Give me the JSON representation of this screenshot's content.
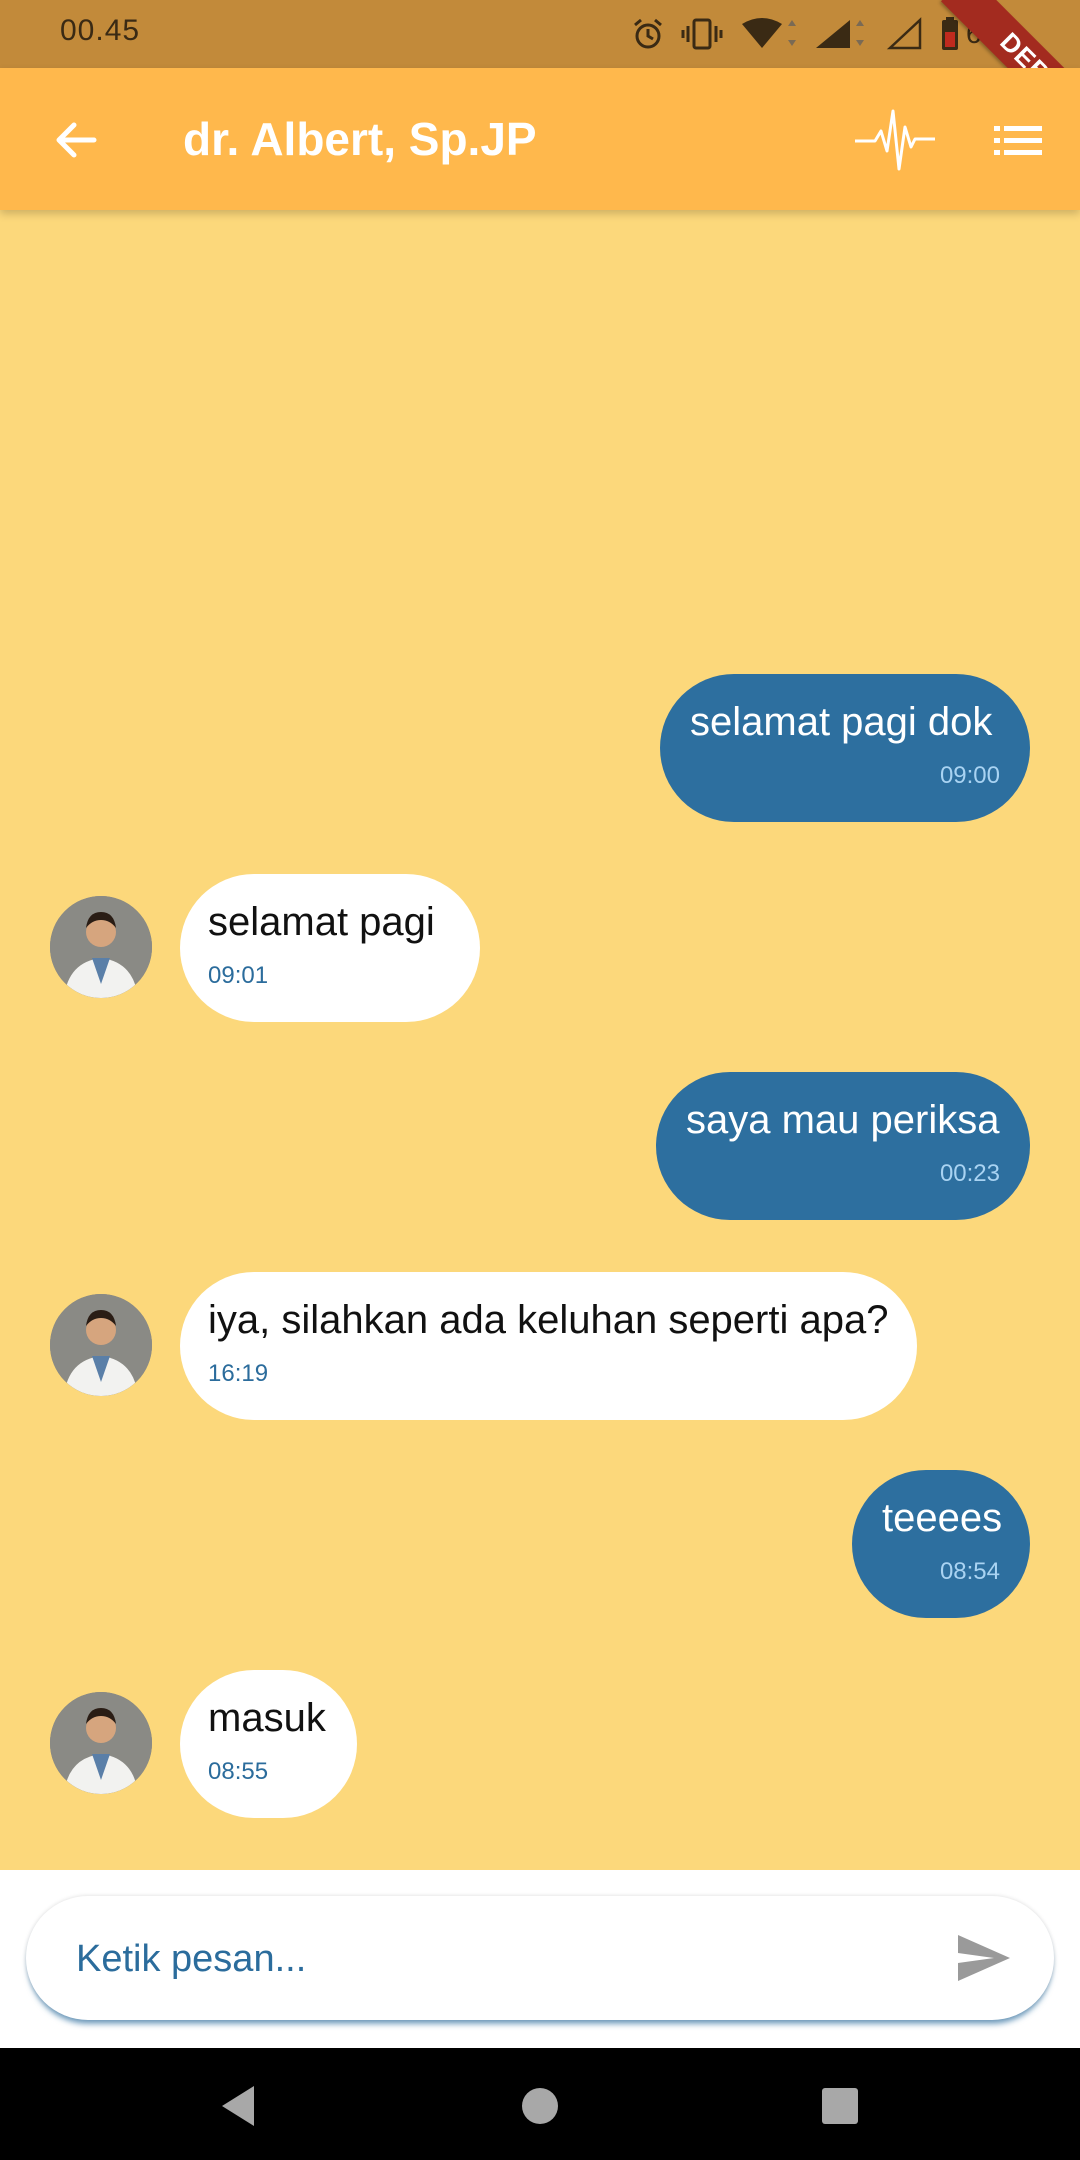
{
  "status_bar": {
    "time": "00.45",
    "battery": "64%",
    "icons": [
      "alarm-icon",
      "vibrate-icon",
      "wifi-icon",
      "signal-icon",
      "signal-empty-icon",
      "battery-icon"
    ]
  },
  "debug_banner": "DEBUG",
  "app_bar": {
    "back_icon": "arrow-back-icon",
    "title": "dr. Albert, Sp.JP",
    "actions": [
      "heartbeat-icon",
      "list-menu-icon"
    ]
  },
  "messages": [
    {
      "from": "me",
      "text": "selamat pagi dok",
      "time": "09:00"
    },
    {
      "from": "doctor",
      "text": "selamat pagi",
      "time": "09:01"
    },
    {
      "from": "me",
      "text": "saya mau periksa",
      "time": "00:23"
    },
    {
      "from": "doctor",
      "text": "iya, silahkan ada keluhan seperti apa?",
      "time": "16:19"
    },
    {
      "from": "me",
      "text": "teeees",
      "time": "08:54"
    },
    {
      "from": "doctor",
      "text": "masuk",
      "time": "08:55"
    }
  ],
  "composer": {
    "placeholder": "Ketik pesan...",
    "send_icon": "send-icon"
  },
  "nav_bar": [
    "back-triangle-icon",
    "home-circle-icon",
    "recents-square-icon"
  ],
  "colors": {
    "status_bar": "#c28a3a",
    "app_bar": "#ffb84c",
    "chat_background": "#fcd87b",
    "outgoing_bubble": "#2d6f9f",
    "incoming_bubble": "#ffffff",
    "accent_text": "#2b6c9c"
  }
}
